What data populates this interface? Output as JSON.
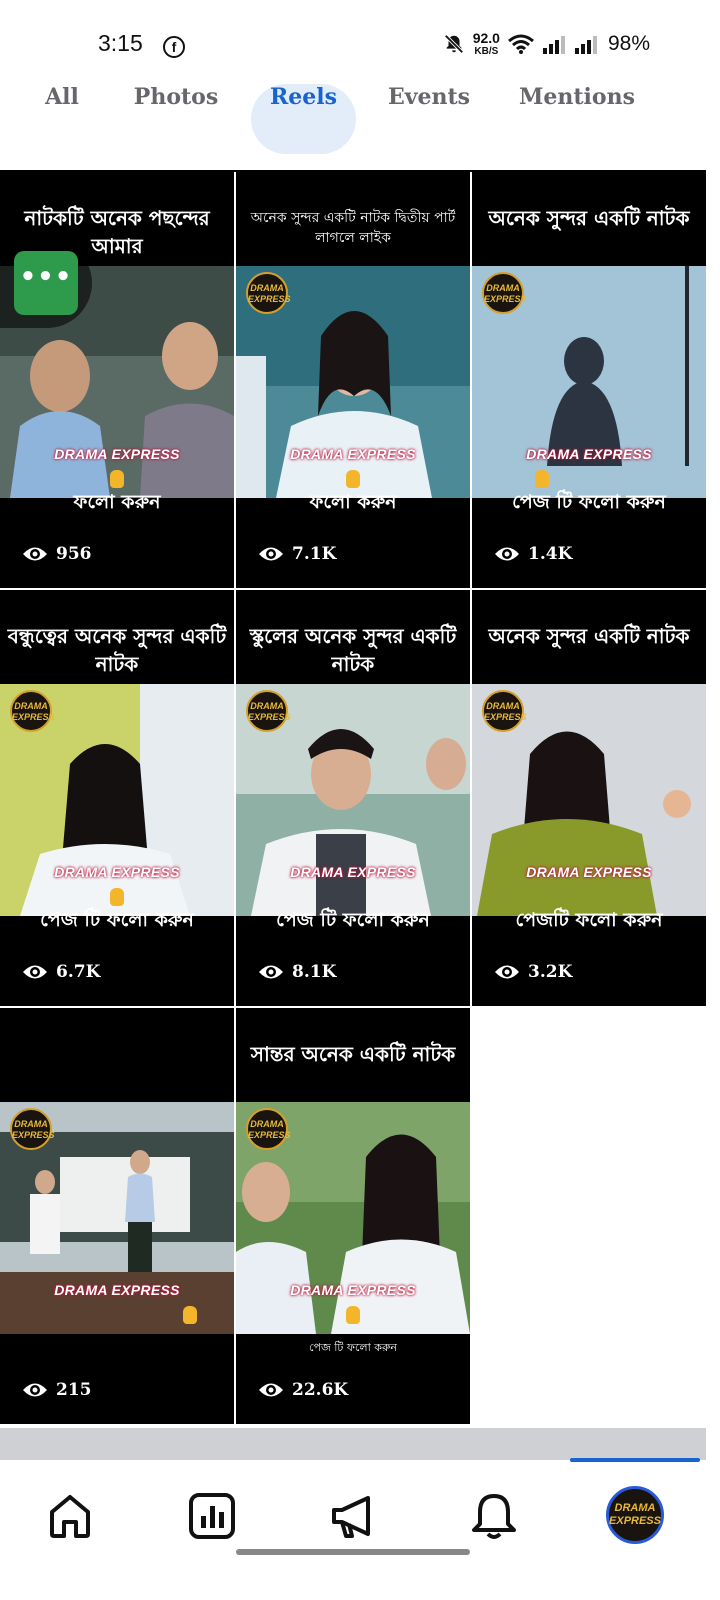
{
  "status_bar": {
    "time": "3:15",
    "app_icon": "facebook-icon",
    "net_speed_value": "92.0",
    "net_speed_unit": "KB/S",
    "battery": "98%"
  },
  "tabs": [
    {
      "label": "All",
      "active": false
    },
    {
      "label": "Photos",
      "active": false
    },
    {
      "label": "Reels",
      "active": true
    },
    {
      "label": "Events",
      "active": false
    },
    {
      "label": "Mentions",
      "active": false
    }
  ],
  "brand": {
    "logo_text": "DRAMA EXPRESS",
    "watermark": "DRAMA EXPRESS",
    "accent": "#1763cf",
    "chat_bubble_color": "#2e9a4c"
  },
  "chat_bubble": {
    "label": "•••"
  },
  "reels": [
    {
      "caption": "নাটকটি অনেক পছন্দের আমার",
      "follow": "ফলো করুন",
      "views": "956"
    },
    {
      "caption": "অনেক সুন্দর একটি নাটক দ্বিতীয় পার্ট লাগলে লাইক",
      "follow": "ফলো করুন",
      "views": "7.1K"
    },
    {
      "caption": "অনেক সুন্দর একটি নাটক",
      "follow": "পেজ টি ফলো করুন",
      "views": "1.4K"
    },
    {
      "caption": "বন্ধুত্বের অনেক সুন্দর একটি নাটক",
      "follow": "পেজ টি ফলো করুন",
      "views": "6.7K"
    },
    {
      "caption": "স্কুলের অনেক সুন্দর একটি নাটক",
      "follow": "পেজ টি ফলো করুন",
      "views": "8.1K"
    },
    {
      "caption": "অনেক সুন্দর একটি নাটক",
      "follow": "পেজটি ফলো করুন",
      "views": "3.2K"
    },
    {
      "caption": "",
      "follow": "",
      "views": "215"
    },
    {
      "caption": "সান্তর অনেক একটি নাটক",
      "follow": "পেজ টি ফলো করুন",
      "views": "22.6K"
    }
  ],
  "bottom_nav": [
    {
      "name": "home-icon"
    },
    {
      "name": "insights-icon"
    },
    {
      "name": "megaphone-icon"
    },
    {
      "name": "bell-icon"
    },
    {
      "name": "profile-avatar"
    }
  ]
}
